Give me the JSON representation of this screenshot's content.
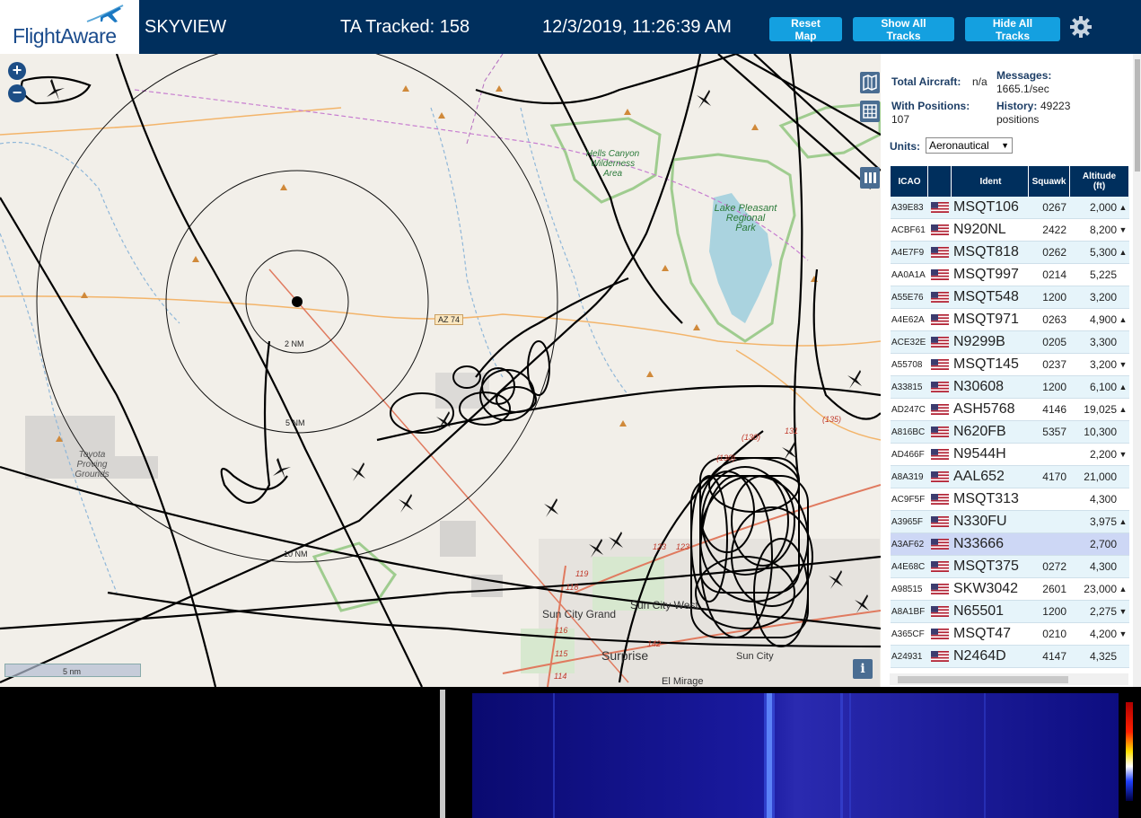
{
  "header": {
    "logo_text": "FlightAware",
    "site_name": "SKYVIEW",
    "ta_tracked": "TA Tracked: 158",
    "clock": "12/3/2019, 11:26:39 AM",
    "buttons": {
      "reset_map": "Reset Map",
      "show_all": "Show All Tracks",
      "hide_all": "Hide All Tracks"
    },
    "colors": {
      "bar": "#002f5d",
      "button": "#14a0e0"
    }
  },
  "map": {
    "zoom_in": "+",
    "zoom_out": "−",
    "info": "i",
    "scale": "5 nm",
    "ring_labels": {
      "r2": "2 NM",
      "r5": "5 NM",
      "r10": "10 NM"
    },
    "places": {
      "hells_canyon_1": "Hells Canyon",
      "hells_canyon_2": "Wilderness",
      "hells_canyon_3": "Area",
      "lake_pleasant_1": "Lake Pleasant",
      "lake_pleasant_2": "Regional",
      "lake_pleasant_3": "Park",
      "toyota_1": "Toyota",
      "toyota_2": "Proving",
      "toyota_3": "Grounds",
      "sun_city_grand": "Sun City Grand",
      "sun_city_west": "Sun City West",
      "surprise": "Surprise",
      "el_mirage": "El Mirage",
      "sun_city": "Sun City"
    },
    "routes": {
      "az74": "AZ 74",
      "r130": "(130)",
      "r131": "131",
      "r135": "(135)",
      "r123a": "123",
      "r123b": "123",
      "r119": "119",
      "r118": "118",
      "r116": "116",
      "r115": "115",
      "r114": "114",
      "r142": "142",
      "r130b": "(130)"
    }
  },
  "sidebar": {
    "total_aircraft_label": "Total Aircraft:",
    "total_aircraft_value": "n/a",
    "messages_label": "Messages:",
    "messages_value": "1665.1/sec",
    "with_positions_label": "With Positions:",
    "with_positions_value": "107",
    "history_label": "History:",
    "history_value_1": "49223",
    "history_value_2": "positions",
    "units_label": "Units:",
    "units_value": "Aeronautical",
    "columns": {
      "icao": "ICAO",
      "flag": "",
      "ident": "Ident",
      "squawk": "Squawk",
      "altitude": "Altitude (ft)"
    },
    "rows": [
      {
        "icao": "A39E83",
        "ident": "MSQT106",
        "squawk": "0267",
        "alt": "2,000",
        "trend": "▲"
      },
      {
        "icao": "ACBF61",
        "ident": "N920NL",
        "squawk": "2422",
        "alt": "8,200",
        "trend": "▼"
      },
      {
        "icao": "A4E7F9",
        "ident": "MSQT818",
        "squawk": "0262",
        "alt": "5,300",
        "trend": "▲"
      },
      {
        "icao": "AA0A1A",
        "ident": "MSQT997",
        "squawk": "0214",
        "alt": "5,225",
        "trend": ""
      },
      {
        "icao": "A55E76",
        "ident": "MSQT548",
        "squawk": "1200",
        "alt": "3,200",
        "trend": ""
      },
      {
        "icao": "A4E62A",
        "ident": "MSQT971",
        "squawk": "0263",
        "alt": "4,900",
        "trend": "▲"
      },
      {
        "icao": "ACE32E",
        "ident": "N9299B",
        "squawk": "0205",
        "alt": "3,300",
        "trend": ""
      },
      {
        "icao": "A55708",
        "ident": "MSQT145",
        "squawk": "0237",
        "alt": "3,200",
        "trend": "▼"
      },
      {
        "icao": "A33815",
        "ident": "N30608",
        "squawk": "1200",
        "alt": "6,100",
        "trend": "▲"
      },
      {
        "icao": "AD247C",
        "ident": "ASH5768",
        "squawk": "4146",
        "alt": "19,025",
        "trend": "▲"
      },
      {
        "icao": "A816BC",
        "ident": "N620FB",
        "squawk": "5357",
        "alt": "10,300",
        "trend": ""
      },
      {
        "icao": "AD466F",
        "ident": "N9544H",
        "squawk": "",
        "alt": "2,200",
        "trend": "▼"
      },
      {
        "icao": "A8A319",
        "ident": "AAL652",
        "squawk": "4170",
        "alt": "21,000",
        "trend": ""
      },
      {
        "icao": "AC9F5F",
        "ident": "MSQT313",
        "squawk": "",
        "alt": "4,300",
        "trend": ""
      },
      {
        "icao": "A3965F",
        "ident": "N330FU",
        "squawk": "",
        "alt": "3,975",
        "trend": "▲"
      },
      {
        "icao": "A3AF62",
        "ident": "N33666",
        "squawk": "",
        "alt": "2,700",
        "trend": ""
      },
      {
        "icao": "A4E68C",
        "ident": "MSQT375",
        "squawk": "0272",
        "alt": "4,300",
        "trend": ""
      },
      {
        "icao": "A98515",
        "ident": "SKW3042",
        "squawk": "2601",
        "alt": "23,000",
        "trend": "▲"
      },
      {
        "icao": "A8A1BF",
        "ident": "N65501",
        "squawk": "1200",
        "alt": "2,275",
        "trend": "▼"
      },
      {
        "icao": "A365CF",
        "ident": "MSQT47",
        "squawk": "0210",
        "alt": "4,200",
        "trend": "▼"
      },
      {
        "icao": "A24931",
        "ident": "N2464D",
        "squawk": "4147",
        "alt": "4,325",
        "trend": ""
      }
    ],
    "selected_row": 15
  }
}
